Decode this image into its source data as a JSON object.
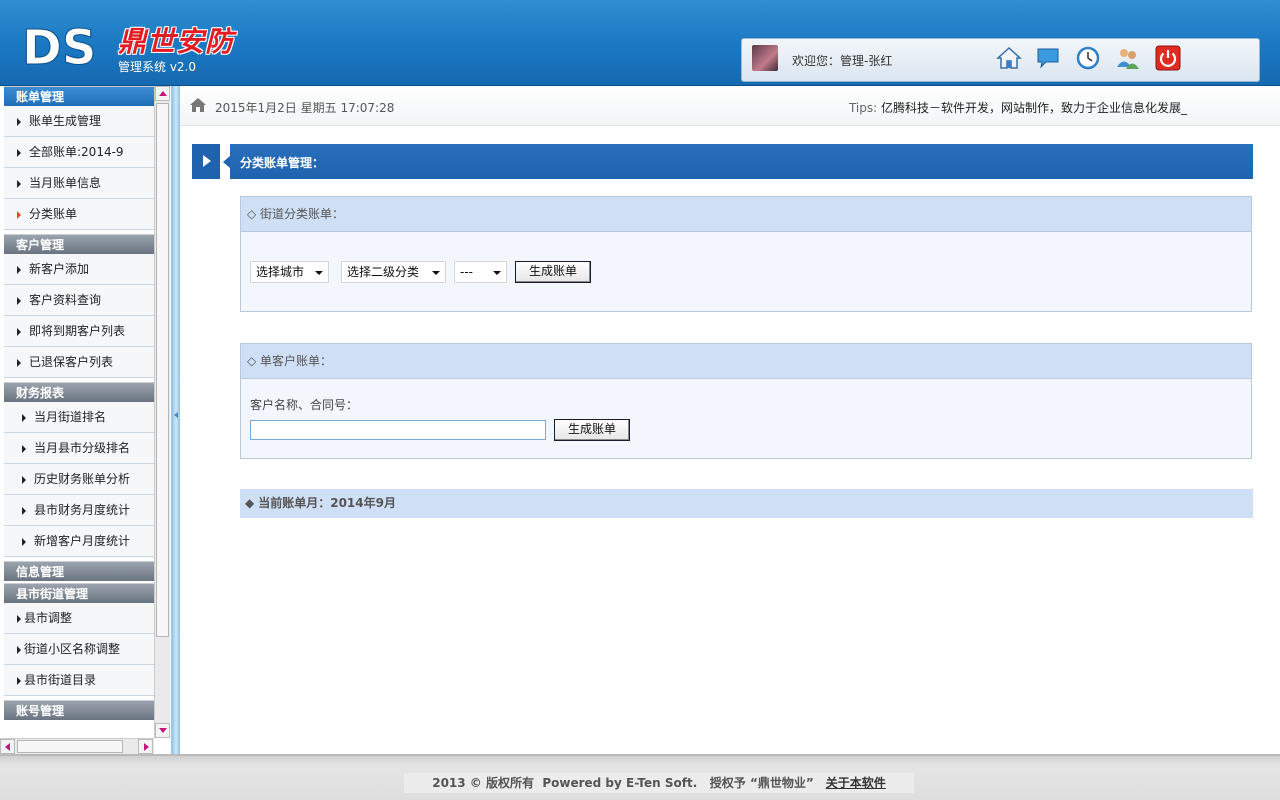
{
  "header": {
    "logo_letters": "DS",
    "brand_name": "鼎世安防",
    "brand_sub": "管理系统 v2.0",
    "welcome": "欢迎您：管理-张红",
    "toolbar_icons": [
      "home-icon",
      "message-icon",
      "clock-icon",
      "users-icon",
      "power-icon"
    ]
  },
  "sidebar": {
    "groups": [
      {
        "title": "账单管理",
        "items": [
          "账单生成管理",
          "全部账单:2014-9",
          "当月账单信息",
          "分类账单"
        ],
        "active_index": 3
      },
      {
        "title": "客户管理",
        "items": [
          "新客户添加",
          "客户资料查询",
          "即将到期客户列表",
          "已退保客户列表"
        ]
      },
      {
        "title": "财务报表",
        "items": [
          "当月街道排名",
          "当月县市分级排名",
          "历史财务账单分析",
          "县市财务月度统计",
          "新增客户月度统计"
        ]
      },
      {
        "title": "信息管理",
        "items": []
      },
      {
        "title": "县市街道管理",
        "items": [
          "县市调整",
          "街道小区名称调整",
          "县市街道目录"
        ]
      },
      {
        "title": "账号管理",
        "items": []
      }
    ]
  },
  "topline": {
    "datetime": "2015年1月2日 星期五 17:07:28",
    "tips_label": "Tips: ",
    "tips_text": "亿腾科技－软件开发，网站制作，致力于企业信息化发展_"
  },
  "page_title": "分类账单管理：",
  "panel1": {
    "title": "◇ 街道分类账单：",
    "select_city": "选择城市",
    "select_category": "选择二级分类",
    "select_third": "---",
    "button": "生成账单"
  },
  "panel2": {
    "title": "◇ 单客户账单：",
    "field_label": "客户名称、合同号：",
    "input_value": "",
    "button": "生成账单"
  },
  "month_bar": {
    "icon": "◆",
    "text": "当前账单月：2014年9月"
  },
  "footer": {
    "copyright": "2013 © 版权所有  Powered by E-Ten Soft.   授权予 “鼎世物业”",
    "about": "关于本软件"
  }
}
